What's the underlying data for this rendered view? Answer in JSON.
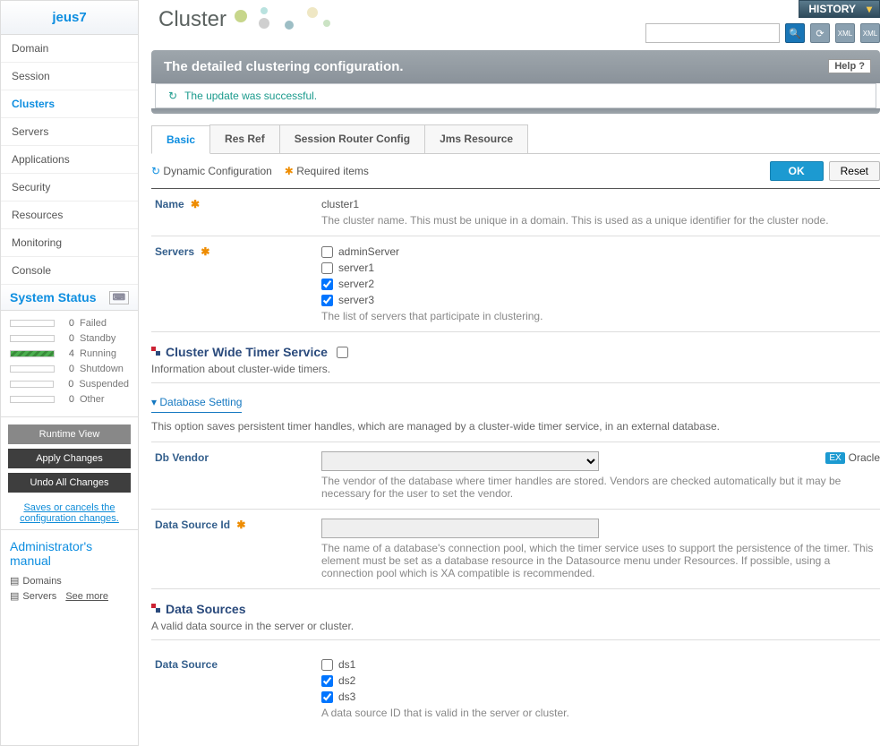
{
  "app_title": "jeus7",
  "page_title": "Cluster",
  "history_button": "HISTORY",
  "nav": {
    "items": [
      "Domain",
      "Session",
      "Clusters",
      "Servers",
      "Applications",
      "Security",
      "Resources",
      "Monitoring",
      "Console"
    ],
    "active": "Clusters"
  },
  "system_status": {
    "header": "System Status",
    "rows": [
      {
        "count": 0,
        "label": "Failed",
        "cls": ""
      },
      {
        "count": 0,
        "label": "Standby",
        "cls": ""
      },
      {
        "count": 4,
        "label": "Running",
        "cls": "running"
      },
      {
        "count": 0,
        "label": "Shutdown",
        "cls": ""
      },
      {
        "count": 0,
        "label": "Suspended",
        "cls": ""
      },
      {
        "count": 0,
        "label": "Other",
        "cls": ""
      }
    ]
  },
  "buttons": {
    "runtime_view": "Runtime View",
    "apply_changes": "Apply Changes",
    "undo_all": "Undo All Changes",
    "save_note": "Saves or cancels the configuration changes."
  },
  "admin_manual": {
    "header": "Administrator's manual",
    "items": [
      "Domains",
      "Servers"
    ],
    "see_more": "See more"
  },
  "detail_header": "The detailed clustering configuration.",
  "help": "Help",
  "update_msg": "The update was successful.",
  "tabs": [
    "Basic",
    "Res Ref",
    "Session Router Config",
    "Jms Resource"
  ],
  "active_tab": "Basic",
  "legend": {
    "dynamic": "Dynamic Configuration",
    "required": "Required items"
  },
  "actions": {
    "ok": "OK",
    "reset": "Reset"
  },
  "form": {
    "name": {
      "label": "Name",
      "value": "cluster1",
      "hint": "The cluster name. This must be unique in a domain. This is used as a unique identifier for the cluster node."
    },
    "servers": {
      "label": "Servers",
      "options": [
        {
          "label": "adminServer",
          "checked": false
        },
        {
          "label": "server1",
          "checked": false
        },
        {
          "label": "server2",
          "checked": true
        },
        {
          "label": "server3",
          "checked": true
        }
      ],
      "hint": "The list of servers that participate in clustering."
    }
  },
  "cluster_timer": {
    "title": "Cluster Wide Timer Service",
    "desc": "Information about cluster-wide timers.",
    "db_setting": {
      "toggle": "Database Setting",
      "desc": "This option saves persistent timer handles, which are managed by a cluster-wide timer service, in an external database.",
      "db_vendor": {
        "label": "Db Vendor",
        "example": "Oracle",
        "hint": "The vendor of the database where timer handles are stored. Vendors are checked automatically but it may be necessary for the user to set the vendor."
      },
      "data_source_id": {
        "label": "Data Source Id",
        "hint": "The name of a database's connection pool, which the timer service uses to support the persistence of the timer. This element must be set as a database resource in the Datasource menu under Resources. If possible, using a connection pool which is XA compatible is recommended."
      }
    }
  },
  "data_sources": {
    "title": "Data Sources",
    "desc": "A valid data source in the server or cluster.",
    "label": "Data Source",
    "options": [
      {
        "label": "ds1",
        "checked": false
      },
      {
        "label": "ds2",
        "checked": true
      },
      {
        "label": "ds3",
        "checked": true
      }
    ],
    "hint": "A data source ID that is valid in the server or cluster."
  }
}
